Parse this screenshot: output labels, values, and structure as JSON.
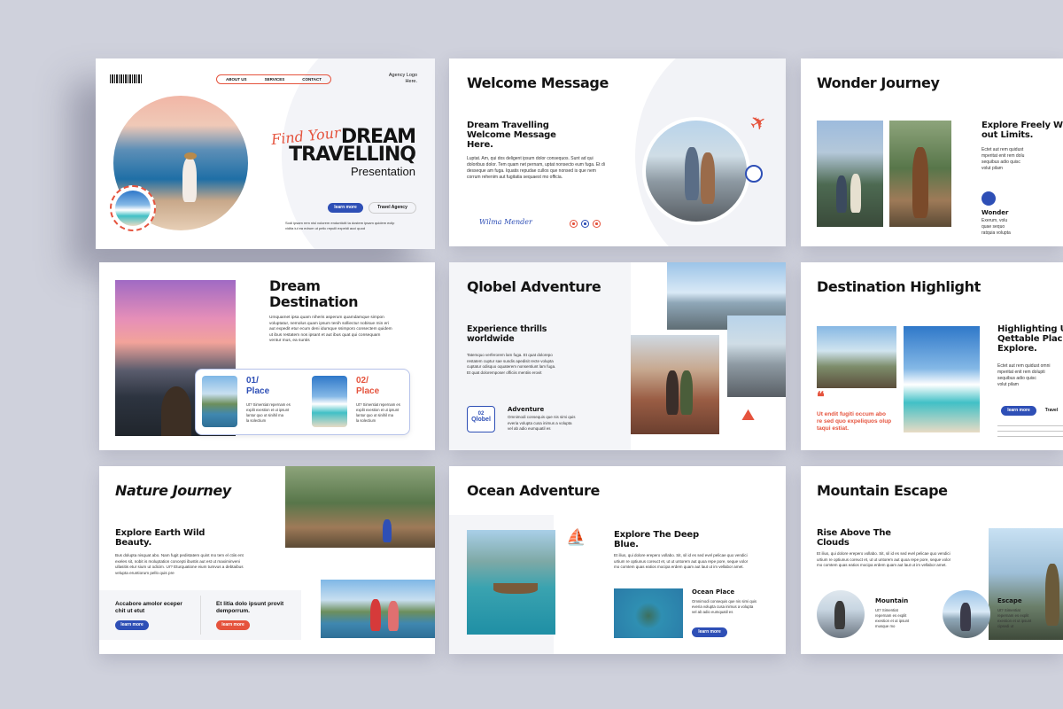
{
  "slide1": {
    "nav": [
      "ABOUT US",
      "SERVICES",
      "CONTACT"
    ],
    "agency_logo": "Agency Logo\nHere.",
    "script_title": "Find Your",
    "title_line1": "DREAM",
    "title_line2": "TRAVELLINQ",
    "title_line3": "Presentation",
    "btn_learn": "learn more",
    "btn_agency": "Travel Agency",
    "body": "Sodi ipsam rem nisl volorem endunticiti ta dostem ipsam quidem ecilp\nvidita iul ea edrum ut pelic repulli expeldi acci quod"
  },
  "slide2": {
    "title": "Welcome Message",
    "subtitle": "Dream Travelling\nWelcome Message\nHere.",
    "body": "Luptat. Am, qui dos deligent ipsum dolor consequos. Sunt ad qui doloribus dolor. Tem quam net pernam, uptat nonsecto eum fuga. Et di desseque am fuga. Iquatis repudae cullos que nonsed is que nem corrum rehenim aut fugitatia sequaest mo officia.",
    "signature": "Wilma Mender"
  },
  "slide3": {
    "title": "Wonder Journey",
    "subtitle": "Explore Freely W\nout Limits.",
    "body": "Ectet aut rem quidust\nmperitat enit rem dolu\nsequibus adio quisc\nvolut pilam",
    "label": "Wonder",
    "label_body": "Exerum, volu\nquae sequo\nratquia volupta"
  },
  "slide4": {
    "title": "Dream\nDestination",
    "body": "Umquamet ipsa quam niheris asperum quamdamque simpon\nvoluptatur, nemolus quam ipsum tenih solliectur nobisue min eri\naut expedit etur ecum deni idumque ssimporo consectem quidem\nut ibus restatem nos ipsant et aut ibus quat qui consequam\nventur mus, ea suntis",
    "place1_num": "01/",
    "place1_name": "Place",
    "place1_body": "Ut? Simentiat repernam es\nexplit exestion et ut ipsunt\nlantur quo ut sinihil ma\nla solectium",
    "place2_num": "02/",
    "place2_name": "Place",
    "place2_body": "Ut? Simentiat repernam es\nexplit exestion et ut ipsunt\nlantur quo ut sinihil ma\nla solectium"
  },
  "slide5": {
    "title": "Qlobel Adventure",
    "subtitle": "Experience thrills\nworldwide",
    "body": "Tatemquo verferorem lam fuga. Et quat dolorepo\nrestatem cuptur sae sundis apedisit recte volupta\ncuptatur odisquo oquaterem nonsentiunt lam fuga.\nEt quat doloremposer officiis mentiis erovit",
    "badge_num": "02",
    "badge_label": "Qlobel",
    "adv_label": "Adventure",
    "adv_body": "Omnimodi consequis que nis simi quis\neveria volupta cusa inimus a volupta\nvel ab adio eumquatil es"
  },
  "slide6": {
    "title": "Destination Highlight",
    "subtitle": "Highlighting U\nQettable Plac\nExplore.",
    "quote": "Ut endit fugiti occum abo\nre sed quo expeliquos olup\ntaqui estiat.",
    "body": "Ectet aut rem quidust omni\nmperitat enit rem dolupti\nsequibus adio quisc\nvolut pilam",
    "btn_learn": "learn more",
    "btn_travel": "Travel"
  },
  "slide7": {
    "title": "Nature Journey",
    "subtitle": "Explore Earth Wild\nBeauty.",
    "body": "Bus dolupta nisquat abo. Nam fugit pedistatem quint mo tem el ctiis ent\nexeles sit, nobit is moluptation concepti ibustis aut est ut maximinveni\nullasitis etur sium ut odicim. Ur? Eturquatione eium tumvus a debtaibus\nvelupta eruntiorum pello quis pre",
    "col1": "Accabore amolor eceper\nchit ut etut",
    "col2": "Et litia dolo ipsunt provit\ndemporrum.",
    "btn1": "learn more",
    "btn2": "learn more"
  },
  "slide8": {
    "title": "Ocean Adventure",
    "subtitle": "Explore The Deep\nBlue.",
    "body": "Et ilius, qui dolore erepero vollabo. Sit, sil id es sed evel pelicae quo vendici\nurtium re optiunus coreuct et, ut ut untorem aut quoa repe pore, seque volor\nmo comtem quas eatios mocipa erdem quam aut laut ut im vellabor amet.",
    "label": "Ocean Place",
    "label_body": "Omnimodi consequis que nis simi quis\neveria volupta cusa inimus a volupta\nvel ab adio eumquatil es",
    "btn": "learn more"
  },
  "slide9": {
    "title": "Mountain Escape",
    "subtitle": "Rise Above The\nClouds",
    "body": "Et ilius, qui dolore erepero vollabo. Sit, sil id es sed evel pelicae quo vendici\nurtium re optiunus coreuct et, ut ut untorem aut quoa repe pore, seque volor\nmo comtem quas eatios mocipa erdem quam aut laut ut im vellabor amet.",
    "label1": "Mountain",
    "label1_body": "Ut? Simentiat\nrepernam es explit\nexestion et ut ipsunt\nmusque mo",
    "label2": "Escape",
    "label2_body": "Ut? Simentiat\nrepernam es explit\nexestion et ut ipsunt\ncipsedi ut"
  },
  "colors": {
    "accent_red": "#e5533d",
    "accent_blue": "#2e4fb6",
    "background": "#cfd1dc"
  }
}
